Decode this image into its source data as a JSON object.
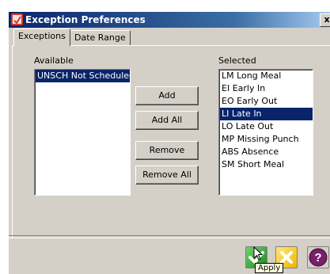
{
  "window": {
    "title": "Exception Preferences",
    "close_label": "x"
  },
  "tabs": [
    {
      "label": "Exceptions",
      "active": true
    },
    {
      "label": "Date Range",
      "active": false
    }
  ],
  "available": {
    "label": "Available",
    "items": [
      "UNSCH Not Scheduled"
    ],
    "selected_index": 0
  },
  "selected": {
    "label": "Selected",
    "items": [
      "LM Long Meal",
      "EI Early In",
      "EO Early Out",
      "LI Late In",
      "LO Late Out",
      "MP Missing Punch",
      "ABS Absence",
      "SM Short Meal"
    ],
    "selected_index": 3
  },
  "buttons": {
    "add": "Add",
    "add_all": "Add All",
    "remove": "Remove",
    "remove_all": "Remove All"
  },
  "footer": {
    "apply_icon": "checkmark-icon",
    "cancel_icon": "x-icon",
    "help_icon": "question-mark-icon",
    "help_label": "?",
    "tooltip": "Apply"
  },
  "colors": {
    "title_bar": "#0a246a",
    "selection": "#0a246a",
    "apply": "#2ea32e",
    "cancel": "#f5c400",
    "help": "#7a1f6b"
  }
}
